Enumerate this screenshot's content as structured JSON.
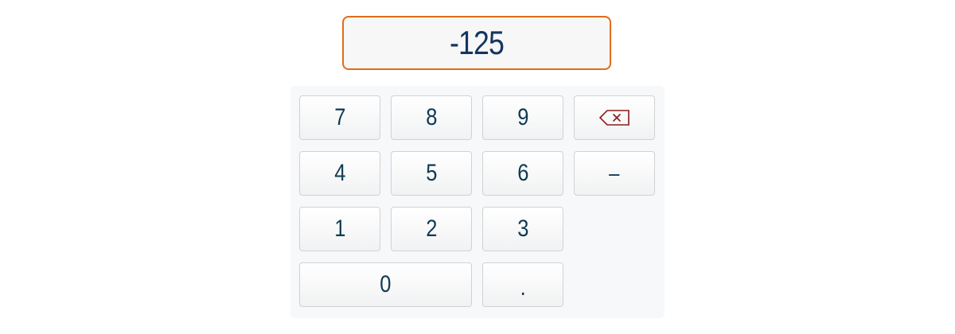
{
  "display": {
    "value": "-125"
  },
  "keys": {
    "k7": "7",
    "k8": "8",
    "k9": "9",
    "k4": "4",
    "k5": "5",
    "k6": "6",
    "k1": "1",
    "k2": "2",
    "k3": "3",
    "k0": "0",
    "dot": ".",
    "minus": "–",
    "backspace_icon": "backspace-icon"
  },
  "colors": {
    "display_border": "#e06c1a",
    "display_text": "#13355f",
    "key_text": "#0f3a52",
    "backspace": "#8b1a1a"
  }
}
